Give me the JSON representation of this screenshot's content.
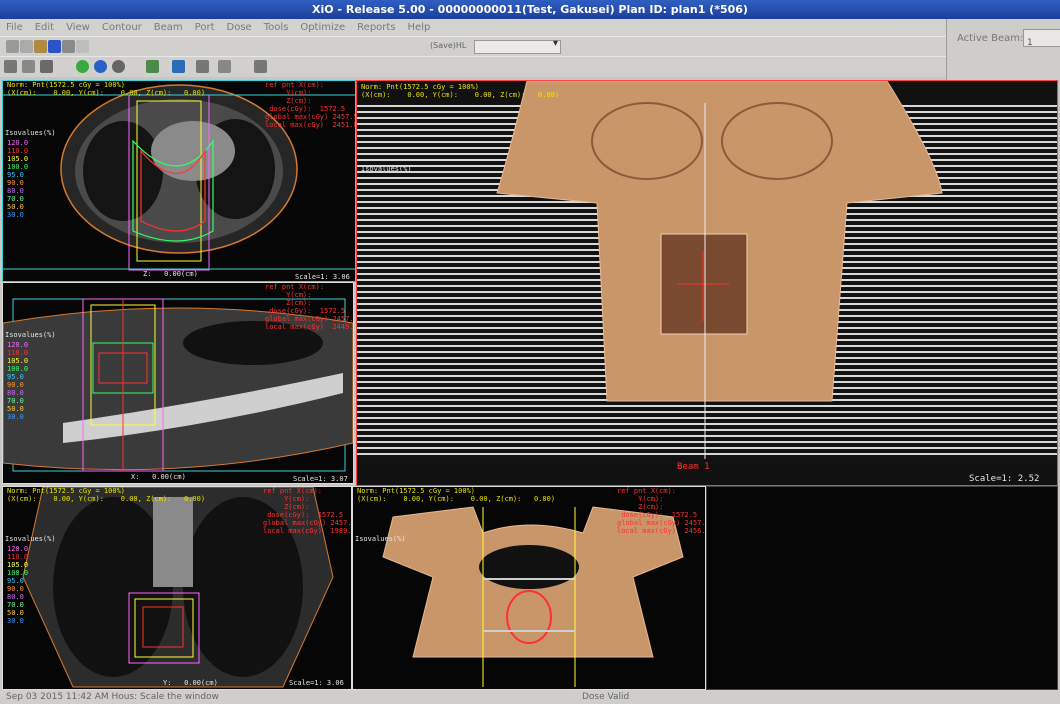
{
  "window": {
    "title": "XiO - Release 5.00 - 00000000011(Test, Gakusei) Plan ID: plan1 (*506)"
  },
  "menu": [
    "File",
    "Edit",
    "View",
    "Contour",
    "Beam",
    "Port",
    "Dose",
    "Tools",
    "Optimize",
    "Reports",
    "Help"
  ],
  "toolbar": {
    "search_label": "(Save)HL",
    "active_beam_label": "Active Beam:",
    "active_beam_value": "1"
  },
  "views": {
    "transverse": {
      "header_left": "Norm: Pnt(1572.5 cGy = 100%)\n(X(cm):    0.00, Y(cm):    0.00, Z(cm):   0.00)",
      "header_right": "ref pnt X(cm):\n     Y(cm):\n     Z(cm):\n dose(cGy):  1572.5\nglobal max(cGy) 2457.5\nlocal max(cGy)  2451.8",
      "isovalues": "Isovalues(%)",
      "iso_list": [
        "120.0",
        "110.0",
        "105.0",
        "100.0",
        "95.0",
        "90.0",
        "80.0",
        "70.0",
        "50.0",
        "30.0"
      ],
      "slice": "Z:   0.00(cm)",
      "scale": "Scale=1: 3.06"
    },
    "sagittal": {
      "header_right": "ref pnt X(cm):\n     Y(cm):\n     Z(cm):\n dose(cGy):  1572.5\nglobal max(cGy) 2457.5\nlocal max(cGy)  2449.0",
      "isovalues": "Isovalues(%)",
      "iso_list": [
        "120.0",
        "110.0",
        "105.0",
        "100.0",
        "95.0",
        "90.0",
        "80.0",
        "70.0",
        "50.0",
        "30.0"
      ],
      "slice": "X:   0.00(cm)",
      "scale": "Scale=1: 3.07"
    },
    "coronal": {
      "header_left": "Norm: Pnt(1572.5 cGy = 100%)\n(X(cm):    0.00, Y(cm):    0.00, Z(cm):   0.00)",
      "header_right": "ref pnt X(cm):\n     Y(cm):\n     Z(cm):\n dose(cGy):  1572.5\nglobal max(cGy) 2457.5\nlocal max(cGy)  1989.0",
      "isovalues": "Isovalues(%)",
      "iso_list": [
        "120.0",
        "110.0",
        "105.0",
        "100.0",
        "95.0",
        "90.0",
        "80.0",
        "70.0",
        "50.0",
        "30.0"
      ],
      "slice": "Y:   0.00(cm)",
      "scale": "Scale=1: 3.06"
    },
    "bev": {
      "header_left": "Norm: Pnt(1572.5 cGy = 100%)\n(X(cm):    0.00, Y(cm):    0.00, Z(cm):   0.00)",
      "isovalues": "Isovalues(%)",
      "beam": "Beam 1",
      "scale": "Scale=1: 2.52"
    },
    "render3d": {
      "header_left": "Norm: Pnt(1572.5 cGy = 100%)\n(X(cm):    0.00, Y(cm):    0.00, Z(cm):   0.00)",
      "header_right": "ref pnt X(cm):\n     Y(cm):\n     Z(cm):\n dose(cGy):  1572.5\nglobal max(cGy) 2457.5\nlocal max(cGy)  2456.0",
      "isovalues": "Isovalues(%)"
    }
  },
  "status": {
    "left": "Sep 03 2015 11:42 AM  Hous:  Scale the window",
    "center": "Dose Valid"
  }
}
